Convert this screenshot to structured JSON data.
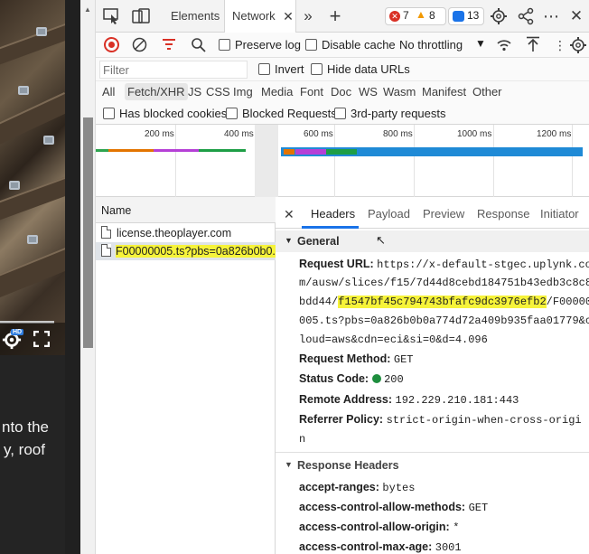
{
  "article": {
    "lines": [
      "nto the",
      "y, roof"
    ]
  },
  "devtools": {
    "tabs": [
      {
        "label": "Elements"
      },
      {
        "label": "Network"
      }
    ],
    "badges": {
      "errors": "7",
      "warnings": "8",
      "info": "13"
    },
    "toolbar": {
      "preserve_log": "Preserve log",
      "disable_cache": "Disable cache",
      "throttling": "No throttling"
    },
    "filter": {
      "placeholder": "Filter",
      "invert": "Invert",
      "hide_data_urls": "Hide data URLs"
    },
    "types": [
      "All",
      "Fetch/XHR",
      "JS",
      "CSS",
      "Img",
      "Media",
      "Font",
      "Doc",
      "WS",
      "Wasm",
      "Manifest",
      "Other"
    ],
    "blocked": {
      "has_blocked_cookies": "Has blocked cookies",
      "blocked_requests": "Blocked Requests",
      "third_party": "3rd-party requests"
    },
    "timeline_ticks": [
      "200 ms",
      "400 ms",
      "600 ms",
      "800 ms",
      "1000 ms",
      "1200 ms"
    ],
    "requests": {
      "column": "Name",
      "rows": [
        {
          "name": "license.theoplayer.com"
        },
        {
          "name": "F00000005.ts?pbs=0a826b0b0..."
        }
      ]
    },
    "details": {
      "tabs": [
        "Headers",
        "Payload",
        "Preview",
        "Response",
        "Initiator"
      ],
      "general": {
        "title": "General",
        "request_url_label": "Request URL:",
        "url_lines": [
          "https://x-default-stgec.uplynk.co",
          "m/ausw/slices/f15/7d44d8cebd184751b43edb3c8c8",
          "005.ts?pbs=0a826b0b0a774d72a409b935faa01779&c",
          "loud=aws&cdn=eci&si=0&d=4.096"
        ],
        "url_line3_prefix": "bdd44/",
        "url_line3_highlight": "f1547bf45c794743bfafc9dc3976efb2",
        "url_line3_suffix": "/F00000",
        "request_method_label": "Request Method:",
        "request_method": "GET",
        "status_code_label": "Status Code:",
        "status_code": "200",
        "remote_address_label": "Remote Address:",
        "remote_address": "192.229.210.181:443",
        "referrer_policy_label": "Referrer Policy:",
        "referrer_policy_line1": "strict-origin-when-cross-origi",
        "referrer_policy_line2": "n"
      },
      "response_headers": {
        "title": "Response Headers",
        "items": [
          {
            "key": "accept-ranges:",
            "value": "bytes"
          },
          {
            "key": "access-control-allow-methods:",
            "value": "GET"
          },
          {
            "key": "access-control-allow-origin:",
            "value": "*"
          },
          {
            "key": "access-control-max-age:",
            "value": "3001"
          }
        ]
      }
    }
  },
  "colors": {
    "accent": "#1a73e8",
    "record": "#d93025",
    "highlight": "#f6f33a",
    "waterfall_bar": "#1f8ad6"
  }
}
